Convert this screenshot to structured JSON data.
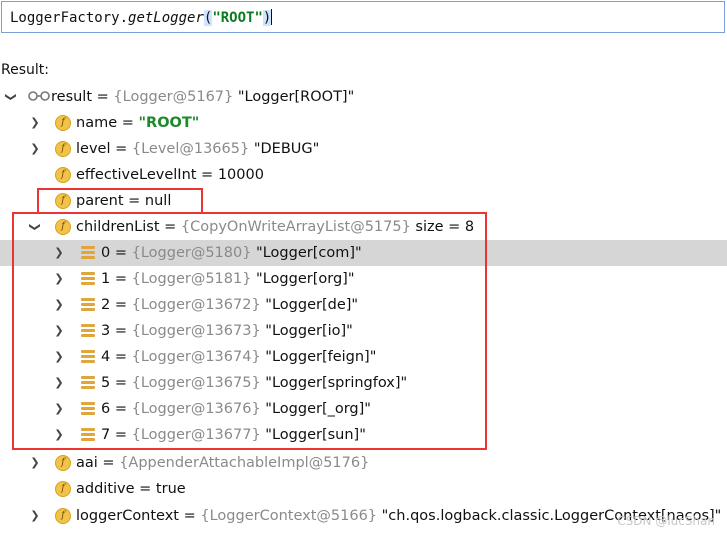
{
  "expression": {
    "prefix": "LoggerFactory.",
    "method": "getLogger",
    "open_paren": "(",
    "arg": "\"ROOT\"",
    "close_paren": ")"
  },
  "result_label": "Result:",
  "root": {
    "name": "result",
    "eq": " = ",
    "ref": "{Logger@5167}",
    "value": " \"Logger[ROOT]\""
  },
  "fields": [
    {
      "name": "name",
      "eq": " = ",
      "ref": "",
      "value": "\"ROOT\""
    },
    {
      "name": "level",
      "eq": " = ",
      "ref": "{Level@13665}",
      "value": " \"DEBUG\""
    },
    {
      "name": "effectiveLevelInt",
      "eq": " = ",
      "ref": "",
      "value": "10000"
    },
    {
      "name": "parent",
      "eq": " = ",
      "ref": "",
      "value": "null"
    },
    {
      "name": "childrenList",
      "eq": " = ",
      "ref": "{CopyOnWriteArrayList@5175}",
      "value": "  size = 8"
    }
  ],
  "children": [
    {
      "index": "0",
      "eq": " = ",
      "ref": "{Logger@5180}",
      "value": " \"Logger[com]\""
    },
    {
      "index": "1",
      "eq": " = ",
      "ref": "{Logger@5181}",
      "value": " \"Logger[org]\""
    },
    {
      "index": "2",
      "eq": " = ",
      "ref": "{Logger@13672}",
      "value": " \"Logger[de]\""
    },
    {
      "index": "3",
      "eq": " = ",
      "ref": "{Logger@13673}",
      "value": " \"Logger[io]\""
    },
    {
      "index": "4",
      "eq": " = ",
      "ref": "{Logger@13674}",
      "value": " \"Logger[feign]\""
    },
    {
      "index": "5",
      "eq": " = ",
      "ref": "{Logger@13675}",
      "value": " \"Logger[springfox]\""
    },
    {
      "index": "6",
      "eq": " = ",
      "ref": "{Logger@13676}",
      "value": " \"Logger[_org]\""
    },
    {
      "index": "7",
      "eq": " = ",
      "ref": "{Logger@13677}",
      "value": " \"Logger[sun]\""
    }
  ],
  "after_fields": [
    {
      "name": "aai",
      "eq": " = ",
      "ref": "{AppenderAttachableImpl@5176}",
      "value": ""
    },
    {
      "name": "additive",
      "eq": " = ",
      "ref": "",
      "value": "true"
    },
    {
      "name": "loggerContext",
      "eq": " = ",
      "ref": "{LoggerContext@5166}",
      "value": " \"ch.qos.logback.classic.LoggerContext[nacos]\""
    }
  ],
  "watermark": "CSDN @lucShan",
  "icons": {
    "field": "field-icon",
    "list_item": "list-item-icon",
    "watch": "watch-glasses-icon"
  },
  "colors": {
    "highlight_box": "#ee3333",
    "string_value": "#1a8a2a",
    "selected_row": "#d6d6d6"
  }
}
